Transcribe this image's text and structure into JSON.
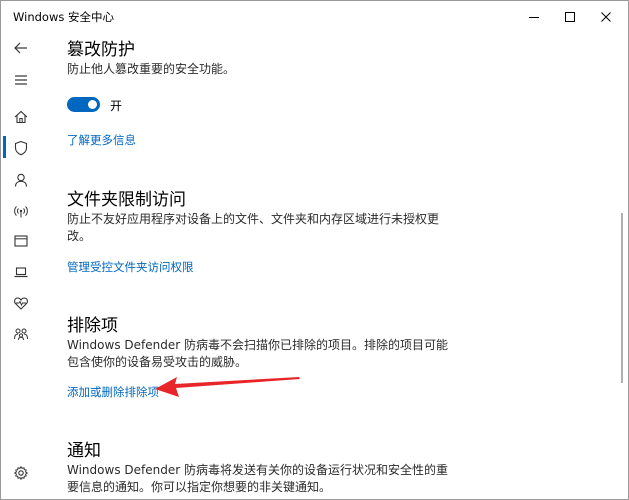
{
  "window": {
    "title": "Windows 安全中心"
  },
  "nav": {
    "items": [
      {
        "icon": "back-arrow-icon"
      },
      {
        "icon": "hamburger-menu-icon"
      },
      {
        "icon": "home-icon"
      },
      {
        "icon": "shield-icon",
        "active": true
      },
      {
        "icon": "person-icon"
      },
      {
        "icon": "wifi-signal-icon"
      },
      {
        "icon": "app-browser-icon"
      },
      {
        "icon": "laptop-icon"
      },
      {
        "icon": "heart-health-icon"
      },
      {
        "icon": "family-icon"
      },
      {
        "icon": "gear-icon"
      }
    ],
    "accent": "#0067c0"
  },
  "sections": {
    "tamper": {
      "title": "篡改防护",
      "desc": "防止他人篡改重要的安全功能。",
      "toggle_state": "开",
      "toggle_on": true,
      "link": "了解更多信息"
    },
    "folder": {
      "title": "文件夹限制访问",
      "desc": "防止不友好应用程序对设备上的文件、文件夹和内存区域进行未授权更改。",
      "link": "管理受控文件夹访问权限"
    },
    "exclusions": {
      "title": "排除项",
      "desc": "Windows Defender 防病毒不会扫描你已排除的项目。排除的项目可能包含使你的设备易受攻击的威胁。",
      "link": "添加或删除排除项"
    },
    "notify": {
      "title": "通知",
      "desc": "Windows Defender 防病毒将发送有关你的设备运行状况和安全性的重要信息的通知。你可以指定你想要的非关键通知。"
    }
  },
  "colors": {
    "link": "#0067c0",
    "arrow": "#e8262a"
  }
}
